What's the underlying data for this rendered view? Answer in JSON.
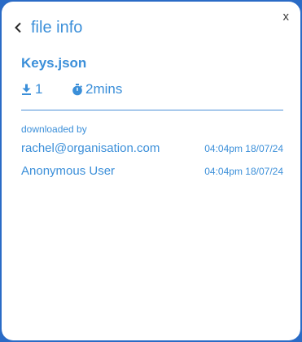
{
  "dialog": {
    "title": "file info",
    "close_label": "x"
  },
  "file": {
    "name": "Keys.json",
    "downloads": "1",
    "expiry": "2mins"
  },
  "downloads_section": {
    "label": "downloaded by",
    "entries": [
      {
        "user": "rachel@organisation.com",
        "time": "04:04pm 18/07/24"
      },
      {
        "user": "Anonymous User",
        "time": "04:04pm 18/07/24"
      }
    ]
  },
  "colors": {
    "accent": "#3b8fd9",
    "frame": "#2a6bc6",
    "background": "#ffffff"
  },
  "icons": {
    "back": "chevron-left-icon",
    "downloads": "download-icon",
    "expiry": "stopwatch-icon"
  }
}
